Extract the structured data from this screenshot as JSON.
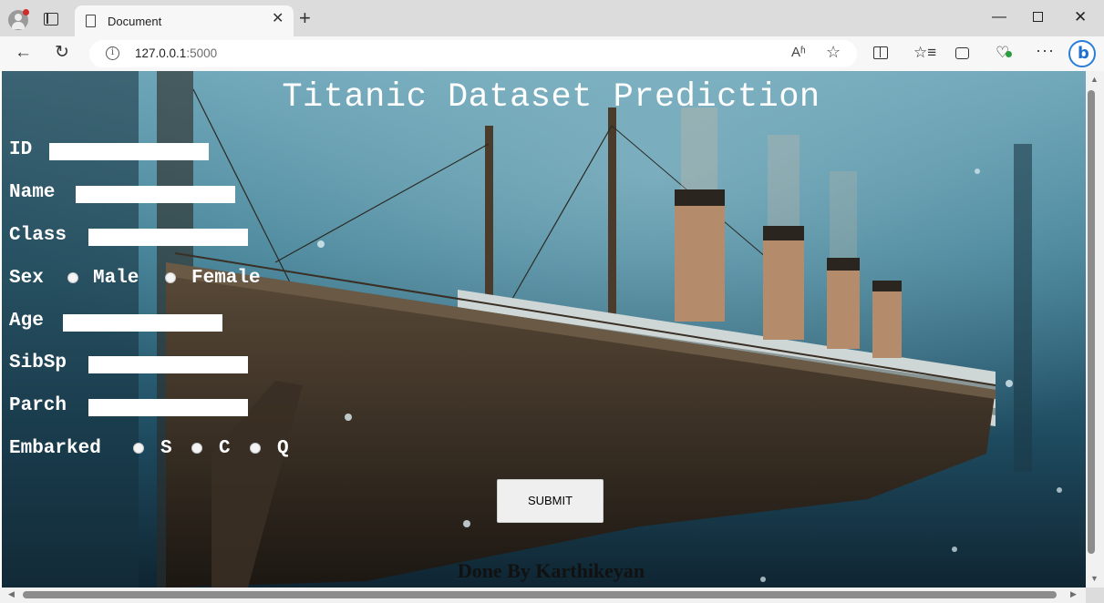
{
  "browser": {
    "tab_title": "Document",
    "url_host": "127.0.0.1",
    "url_port": ":5000",
    "icons": {
      "profile": "profile-icon",
      "tab_actions": "tab-actions-icon",
      "page": "page-icon",
      "close": "close-icon",
      "new_tab": "plus-icon",
      "back": "arrow-left-icon",
      "reload": "reload-icon",
      "info": "info-icon",
      "read_aloud": "read-aloud-icon",
      "favorite": "star-icon",
      "split_screen": "split-screen-icon",
      "favorites": "favorites-icon",
      "collections": "collections-icon",
      "browser_essentials": "heart-pulse-icon",
      "more": "more-icon",
      "copilot": "copilot-icon"
    },
    "glyphs": {
      "close": "✕",
      "new_tab": "+",
      "back": "←",
      "reload": "↻",
      "info": "i",
      "read_aloud": "Aʱ",
      "favorite": "☆",
      "favorites": "☆≡",
      "browser_essentials": "♡",
      "more": "···",
      "minimize": "—",
      "win_close": "✕",
      "copilot": "b"
    }
  },
  "page": {
    "title": "Titanic Dataset Prediction",
    "form": {
      "id_label": "ID",
      "name_label": "Name",
      "class_label": "Class",
      "sex_label": "Sex",
      "sex_options": [
        "Male",
        "Female"
      ],
      "age_label": "Age",
      "sibsp_label": "SibSp",
      "parch_label": "Parch",
      "embarked_label": "Embarked",
      "embarked_options": [
        "S",
        "C",
        "Q"
      ]
    },
    "submit_label": "SUBMIT",
    "footer": "Done By Karthikeyan",
    "background_colors": {
      "deep": "#0f2430",
      "mid": "#24536a",
      "light": "#5b97ab",
      "hull": "#3a3026",
      "superstructure": "#d7dcdc",
      "funnel": "#b48c6c"
    }
  }
}
